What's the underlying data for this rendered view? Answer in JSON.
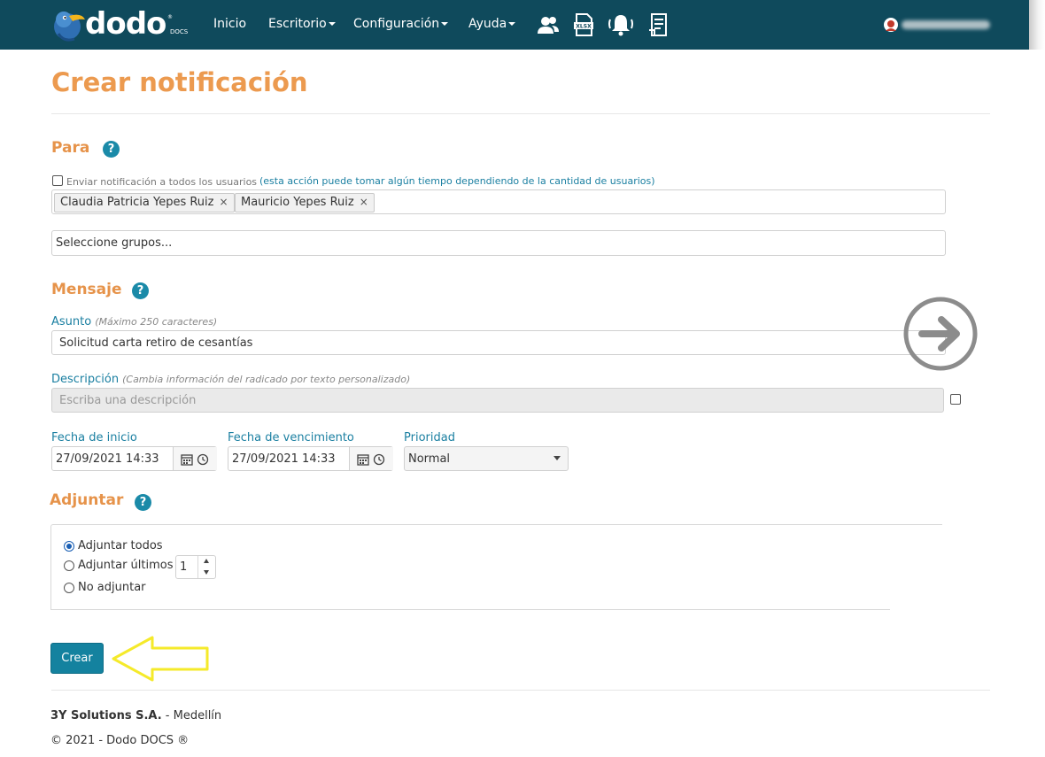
{
  "navbar": {
    "logo_text": "dodo",
    "logo_sub": "DOCS",
    "logo_reg": "®",
    "menu": [
      {
        "label": "Inicio"
      },
      {
        "label": "Escritorio"
      },
      {
        "label": "Configuración"
      },
      {
        "label": "Ayuda"
      }
    ],
    "icons": [
      "users-icon",
      "xlsx-icon",
      "notification-bell-icon",
      "document-list-icon"
    ],
    "user_icon": "user-avatar-icon"
  },
  "page": {
    "title": "Crear notificación"
  },
  "para": {
    "title": "Para",
    "help": "?",
    "send_all_label": "Enviar notificación a todos los usuarios",
    "send_all_note": "(esta acción puede tomar algún tiempo dependiendo de la cantidad de usuarios)",
    "send_all_checked": false,
    "recipients": [
      {
        "name": "Claudia Patricia Yepes Ruiz",
        "remove": "×"
      },
      {
        "name": "Mauricio Yepes Ruiz",
        "remove": "×"
      }
    ],
    "groups_placeholder": "Seleccione grupos..."
  },
  "mensaje": {
    "title": "Mensaje",
    "help": "?",
    "asunto_label": "Asunto",
    "asunto_hint": "(Máximo 250 caracteres)",
    "asunto_value": "Solicitud carta retiro de cesantías",
    "descripcion_label": "Descripción",
    "descripcion_hint": "(Cambia información del radicado por texto personalizado)",
    "descripcion_placeholder": "Escriba una descripción",
    "descripcion_checked": false,
    "fecha_inicio_label": "Fecha de inicio",
    "fecha_inicio_value": "27/09/2021 14:33",
    "fecha_venc_label": "Fecha de vencimiento",
    "fecha_venc_value": "27/09/2021 14:33",
    "prioridad_label": "Prioridad",
    "prioridad_value": "Normal"
  },
  "adjuntar": {
    "title": "Adjuntar",
    "help": "?",
    "options": [
      {
        "label": "Adjuntar todos",
        "selected": true
      },
      {
        "label": "Adjuntar últimos",
        "selected": false
      },
      {
        "label": "No adjuntar",
        "selected": false
      }
    ],
    "ultimos_value": "1"
  },
  "actions": {
    "crear_label": "Crear"
  },
  "footer": {
    "company": "3Y Solutions S.A.",
    "city": " - Medellín",
    "copyright": "© 2021 - Dodo DOCS ®"
  },
  "colors": {
    "navbar": "#0f4a5c",
    "heading": "#ec9a4f",
    "link": "#1a7fa1",
    "primary_button": "#14829f",
    "annotation_arrow": "#f5ea2a"
  }
}
